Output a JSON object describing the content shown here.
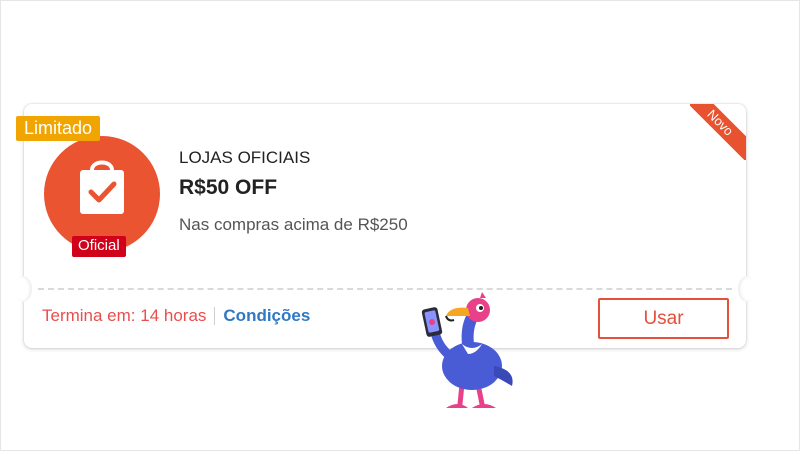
{
  "coupon": {
    "badge_limited": "Limitado",
    "badge_new": "Novo",
    "badge_official": "Oficial",
    "store_name": "LOJAS OFICIAIS",
    "discount": "R$50 OFF",
    "min_spend": "Nas compras acima de R$250",
    "expire_text": "Termina em: 14 horas",
    "conditions_label": "Condições",
    "use_button_label": "Usar"
  },
  "icons": {
    "logo": "shopping-bag-check-icon",
    "mascot": "flamingo-mascot-with-phone"
  },
  "colors": {
    "brand_orange": "#ea5430",
    "limited_badge": "#f0a500",
    "official_badge": "#d0011b",
    "expire_red": "#e94e4e",
    "link_blue": "#2f78c4"
  }
}
